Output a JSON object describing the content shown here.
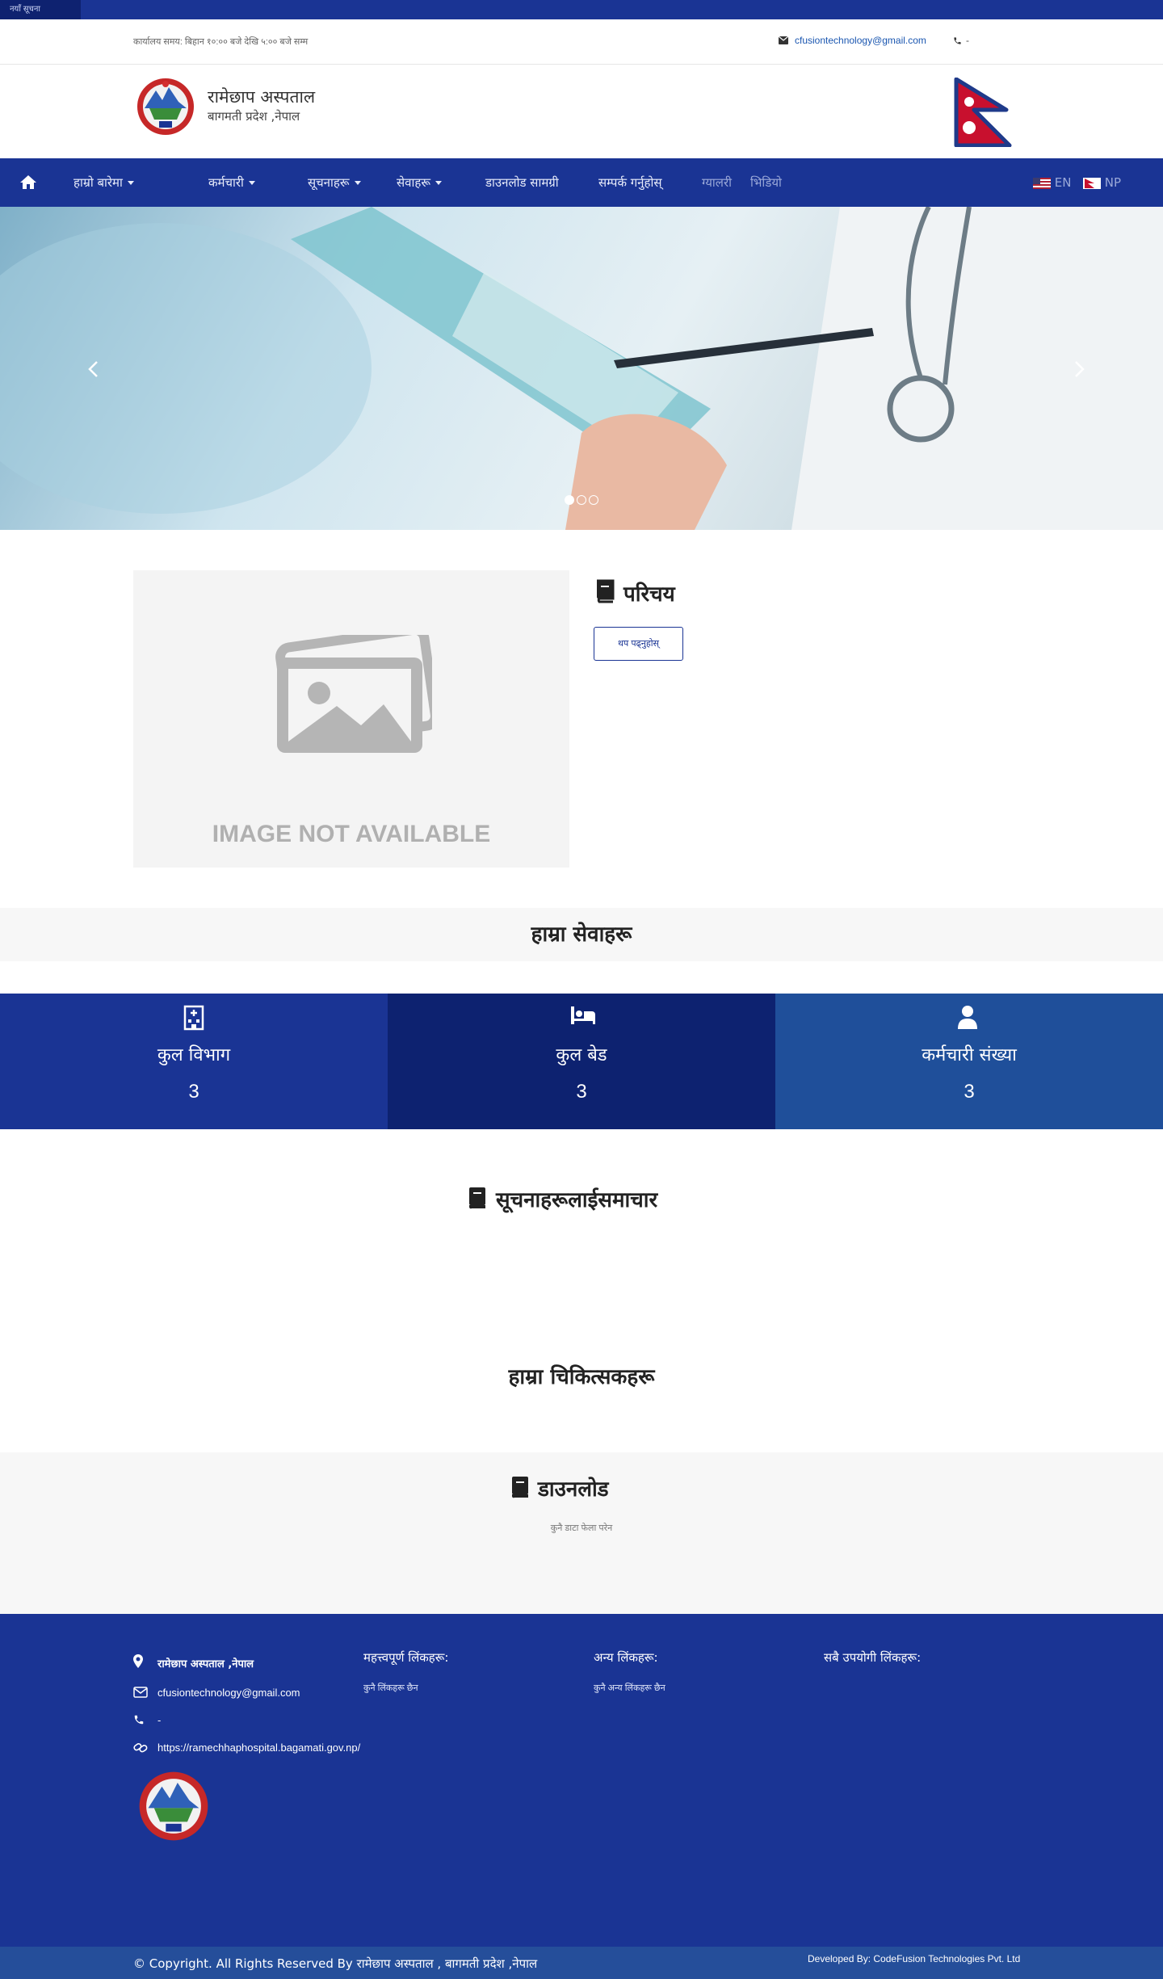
{
  "top_strip": {
    "tag": "नयाँ सूचना"
  },
  "info_bar": {
    "hours": "कार्यालय समय: बिहान १०:०० बजे देखि ५:०० बजे सम्म",
    "email": "cfusiontechnology@gmail.com",
    "phone": "-"
  },
  "brand": {
    "title": "रामेछाप अस्पताल",
    "subtitle": "बागमती प्रदेश ,नेपाल"
  },
  "nav": {
    "items": [
      {
        "label": "हाम्रो बारेमा",
        "dropdown": true
      },
      {
        "label": "कर्मचारी",
        "dropdown": true
      },
      {
        "label": "सूचनाहरू",
        "dropdown": true
      },
      {
        "label": "सेवाहरू",
        "dropdown": true
      },
      {
        "label": "डाउनलोड सामग्री",
        "dropdown": false
      },
      {
        "label": "सम्पर्क गर्नुहोस्",
        "dropdown": false
      },
      {
        "label": "ग्यालरी",
        "dropdown": false
      },
      {
        "label": "भिडियो",
        "dropdown": false
      }
    ],
    "lang_en": "EN",
    "lang_np": "NP"
  },
  "hero": {
    "slides": 3,
    "active_slide": 1
  },
  "about": {
    "heading": "परिचय",
    "placeholder_text": "IMAGE NOT AVAILABLE",
    "more_button": "थप पढ्नुहोस्"
  },
  "services": {
    "heading": "हाम्रा सेवाहरू"
  },
  "stats": [
    {
      "label": "कुल विभाग",
      "value": "3",
      "icon": "hospital-icon",
      "color": "#1a3494"
    },
    {
      "label": "कुल बेड",
      "value": "3",
      "icon": "bed-icon",
      "color": "#0d2270"
    },
    {
      "label": "कर्मचारी संख्या",
      "value": "3",
      "icon": "user-icon",
      "color": "#1f4f9a"
    }
  ],
  "notices": {
    "heading": "सूचनाहरूलाईसमाचार",
    "second_heading": "हाम्रा चिकित्सकहरू"
  },
  "downloads": {
    "heading": "डाउनलोड",
    "empty_text": "कुनै डाटा फेला परेन"
  },
  "footer": {
    "address": "रामेछाप अस्पताल ,नेपाल",
    "email": "cfusiontechnology@gmail.com",
    "phone": "-",
    "website": "https://ramechhaphospital.bagamati.gov.np/",
    "col2_head": "महत्त्वपूर्ण लिंकहरू:",
    "col2_text": "कुनै लिंकहरू छैन",
    "col3_head": "अन्य लिंकहरू:",
    "col3_text": "कुनै अन्य लिंकहरू छैन",
    "col4_head": "सबै उपयोगी लिंकहरू:"
  },
  "copyright": {
    "left": "© Copyright. All Rights Reserved By रामेछाप अस्पताल , बागमती प्रदेश ,नेपाल",
    "right": "Developed By: CodeFusion Technologies Pvt. Ltd"
  },
  "colors": {
    "primary": "#1a3494",
    "dark": "#0d2270",
    "accent": "#1f4f9a"
  }
}
